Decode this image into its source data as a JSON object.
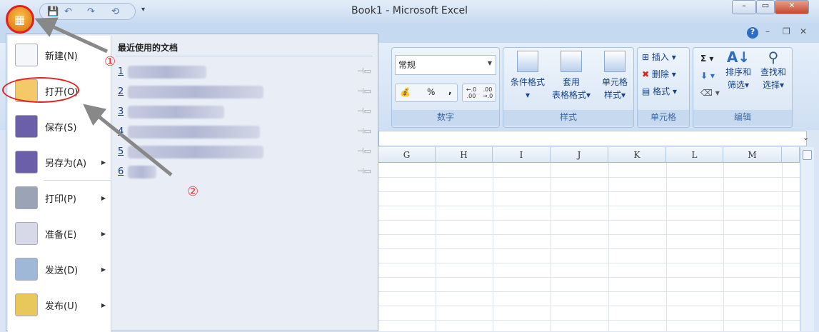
{
  "window": {
    "title": "Book1 - Microsoft Excel",
    "minimize": "–",
    "restore": "▭",
    "close": "✕"
  },
  "ribbon_controls": {
    "help": "?",
    "minimize": "–",
    "restore": "❐",
    "close": "✕"
  },
  "number_group": {
    "format_value": "常规",
    "percent": "%",
    "comma": ",",
    "increase_decimal": "←.0 .00",
    "decrease_decimal": ".00 →.0",
    "label": "数字"
  },
  "styles_group": {
    "conditional": "条件格式",
    "table_format_1": "套用",
    "table_format_2": "表格格式",
    "cell_styles_1": "单元格",
    "cell_styles_2": "样式",
    "label": "样式"
  },
  "cells_group": {
    "insert": "插入",
    "delete": "删除",
    "format": "格式",
    "label": "单元格"
  },
  "editing_group": {
    "sum": "Σ",
    "sort_1": "排序和",
    "sort_2": "筛选",
    "find_1": "查找和",
    "find_2": "选择",
    "label": "编辑"
  },
  "columns": [
    "G",
    "H",
    "I",
    "J",
    "K",
    "L",
    "M"
  ],
  "office_menu": {
    "items": [
      {
        "label": "新建(N)",
        "icon": "new-document-icon"
      },
      {
        "label": "打开(O)",
        "icon": "open-folder-icon"
      },
      {
        "label": "保存(S)",
        "icon": "save-icon"
      },
      {
        "label": "另存为(A)",
        "icon": "save-as-icon",
        "submenu": true
      },
      {
        "label": "打印(P)",
        "icon": "print-icon",
        "submenu": true
      },
      {
        "label": "准备(E)",
        "icon": "prepare-icon",
        "submenu": true
      },
      {
        "label": "发送(D)",
        "icon": "send-icon",
        "submenu": true
      },
      {
        "label": "发布(U)",
        "icon": "publish-icon",
        "submenu": true
      }
    ],
    "recent_title": "最近使用的文档",
    "recent": [
      {
        "num": "1"
      },
      {
        "num": "2"
      },
      {
        "num": "3"
      },
      {
        "num": "4"
      },
      {
        "num": "5"
      },
      {
        "num": "6"
      }
    ]
  },
  "annotations": {
    "step1": "①",
    "step2": "②",
    "highlight_color": "#e52020"
  }
}
